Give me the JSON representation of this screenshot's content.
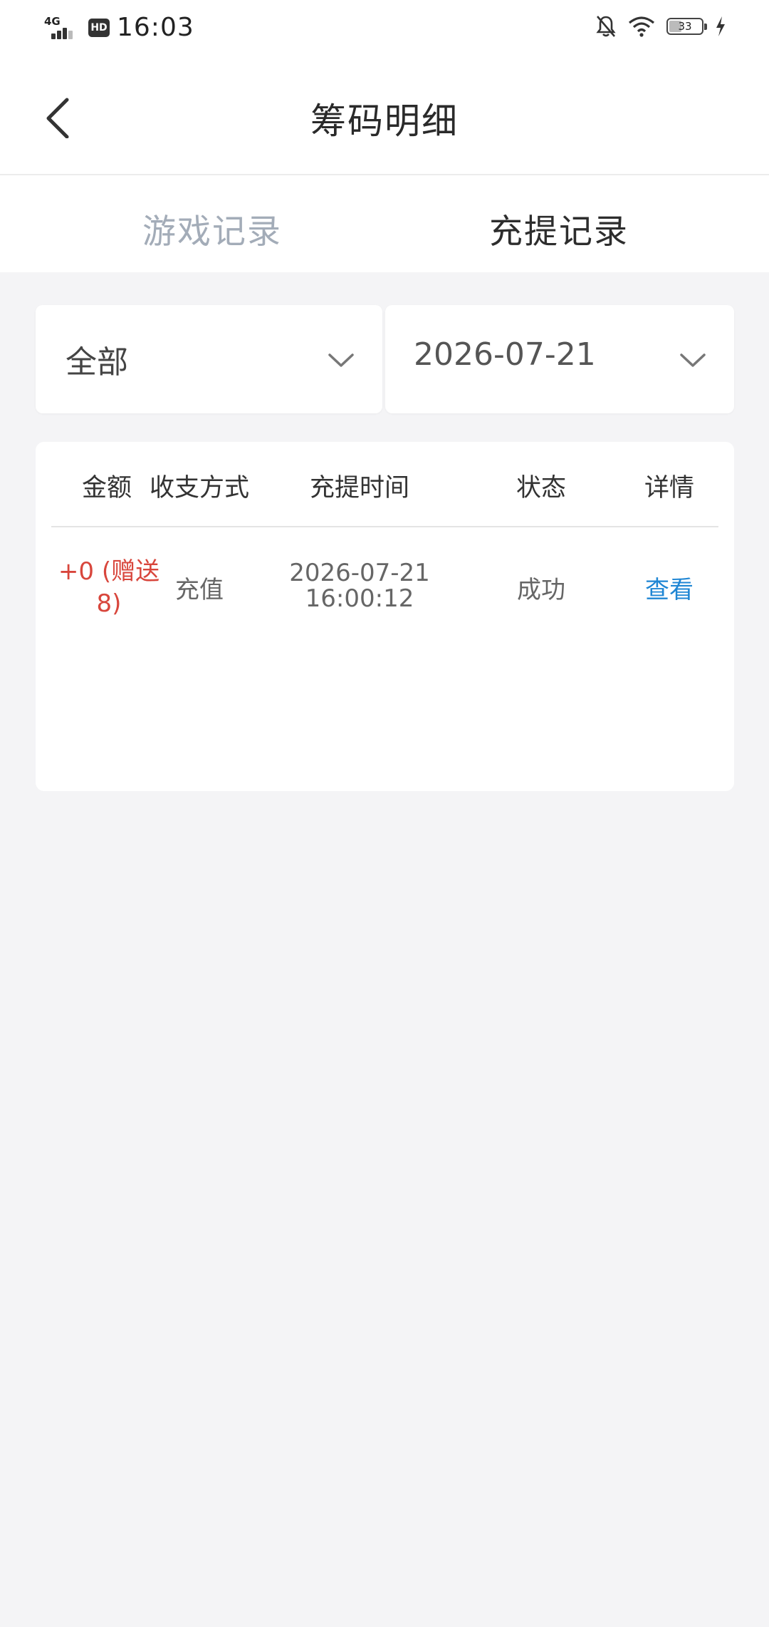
{
  "status_bar": {
    "network": "4G",
    "hd": "HD",
    "time": "16:03",
    "battery": "33"
  },
  "header": {
    "title": "筹码明细"
  },
  "tabs": [
    {
      "label": "游戏记录",
      "active": false
    },
    {
      "label": "充提记录",
      "active": true
    }
  ],
  "filters": {
    "type_selected": "全部",
    "date_selected": "2026-07-21"
  },
  "table": {
    "columns": [
      "金额",
      "收支方式",
      "充提时间",
      "状态",
      "详情"
    ],
    "rows": [
      {
        "amount_line1": "+0 (赠送",
        "amount_line2": "8)",
        "method": "充值",
        "date": "2026-07-21",
        "time": "16:00:12",
        "status": "成功",
        "detail": "查看"
      }
    ]
  },
  "colors": {
    "amount": "#d8463c",
    "link": "#1f86d4",
    "inactive_tab": "#a3acb8",
    "background": "#f4f4f6"
  }
}
